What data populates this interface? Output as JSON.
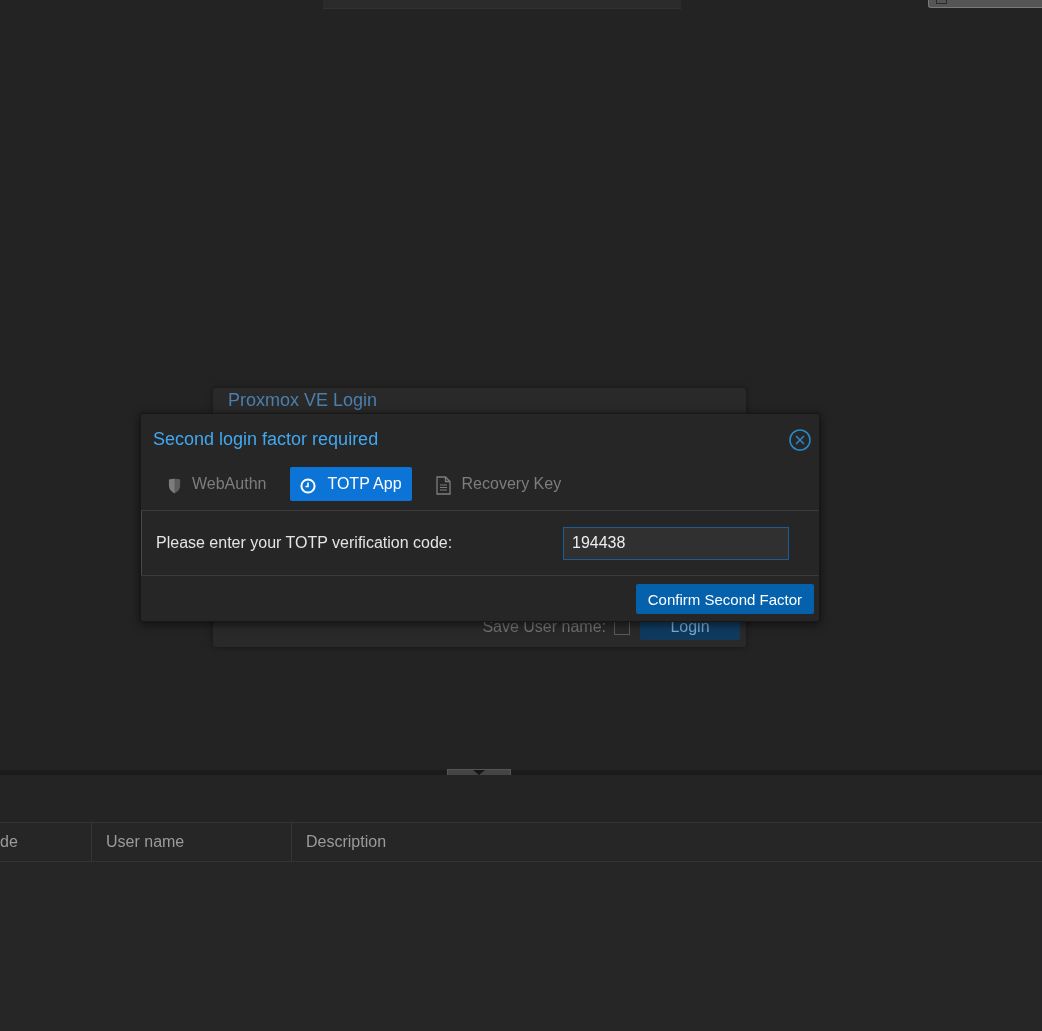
{
  "login_window": {
    "title": "Proxmox VE Login",
    "save_username_label": "Save User name:",
    "save_username_checked": false,
    "login_button": "Login"
  },
  "dialog": {
    "title": "Second login factor required",
    "tabs": [
      {
        "label": "WebAuthn",
        "kind": "webauthn",
        "selected": false
      },
      {
        "label": "TOTP App",
        "kind": "totp",
        "selected": true
      },
      {
        "label": "Recovery Key",
        "kind": "recovery",
        "selected": false
      }
    ],
    "code_label": "Please enter your TOTP verification code:",
    "code_field": {
      "value": "194438"
    },
    "confirm_button": "Confirm Second Factor"
  },
  "bottom_panel": {
    "table": {
      "columns": [
        "de",
        "User name",
        "Description"
      ]
    }
  }
}
